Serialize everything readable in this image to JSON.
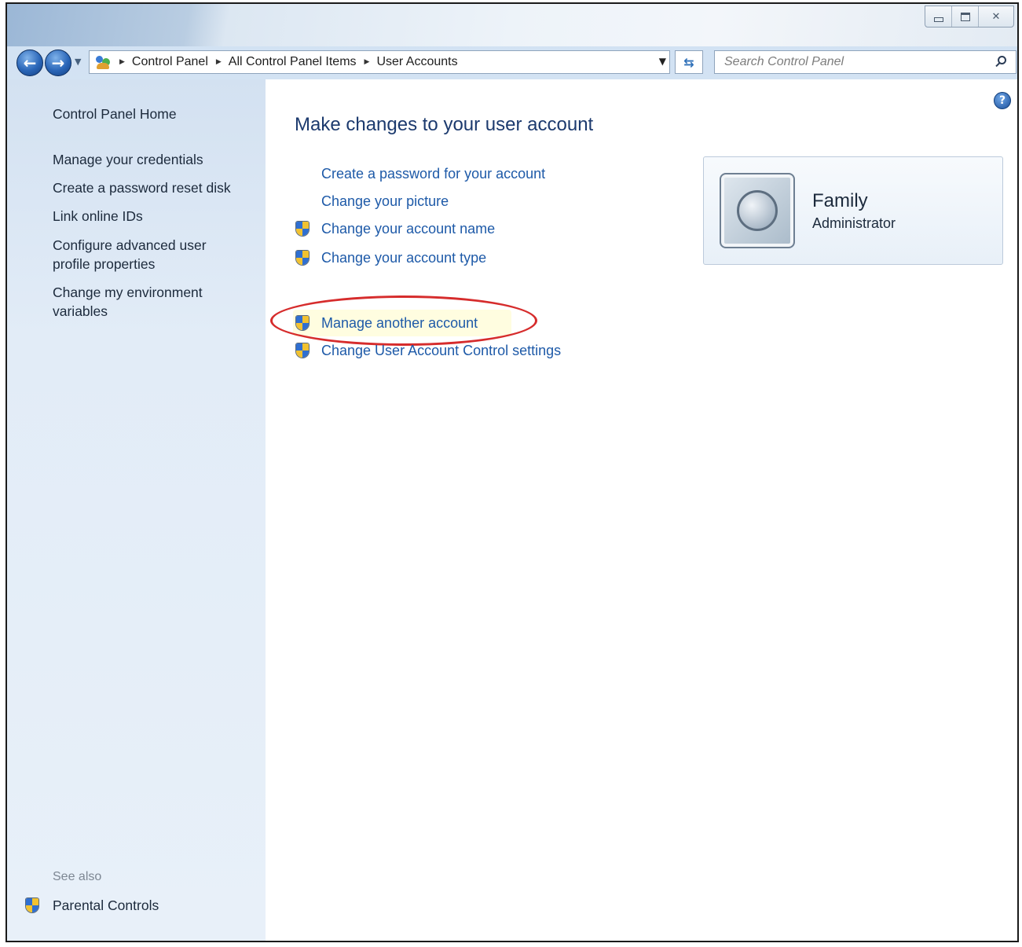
{
  "address_bar": {
    "breadcrumbs": [
      "Control Panel",
      "All Control Panel Items",
      "User Accounts"
    ]
  },
  "search": {
    "placeholder": "Search Control Panel"
  },
  "sidebar": {
    "links": [
      "Control Panel Home",
      "Manage your credentials",
      "Create a password reset disk",
      "Link online IDs",
      "Configure advanced user profile properties",
      "Change my environment variables"
    ],
    "see_also_label": "See also",
    "see_also_links": [
      "Parental Controls"
    ]
  },
  "main": {
    "title": "Make changes to your user account",
    "tasks": [
      {
        "label": "Create a password for your account",
        "shield": false
      },
      {
        "label": "Change your picture",
        "shield": false
      },
      {
        "label": "Change your account name",
        "shield": true
      },
      {
        "label": "Change your account type",
        "shield": true
      }
    ],
    "other_tasks": [
      {
        "label": "Manage another account",
        "shield": true,
        "highlighted": true
      },
      {
        "label": "Change User Account Control settings",
        "shield": true
      }
    ]
  },
  "user": {
    "name": "Family",
    "role": "Administrator"
  },
  "colors": {
    "link": "#1e5aa8",
    "title": "#1c3a6e",
    "annotation": "#d62c2c"
  }
}
